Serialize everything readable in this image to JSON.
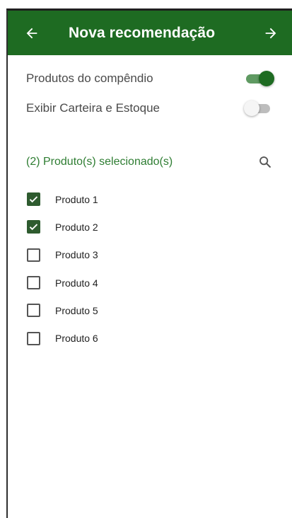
{
  "header": {
    "title": "Nova recomendação",
    "back_icon": "arrow-left-icon",
    "forward_icon": "arrow-right-icon",
    "background": "#1e6b22"
  },
  "settings": [
    {
      "label": "Produtos do compêndio",
      "enabled": true
    },
    {
      "label": "Exibir Carteira e Estoque",
      "enabled": false
    }
  ],
  "selection": {
    "summary": "(2) Produto(s) selecionado(s)",
    "search_icon": "search-icon"
  },
  "products": [
    {
      "label": "Produto 1",
      "checked": true
    },
    {
      "label": "Produto 2",
      "checked": true
    },
    {
      "label": "Produto 3",
      "checked": false
    },
    {
      "label": "Produto 4",
      "checked": false
    },
    {
      "label": "Produto 5",
      "checked": false
    },
    {
      "label": "Produto 6",
      "checked": false
    }
  ]
}
